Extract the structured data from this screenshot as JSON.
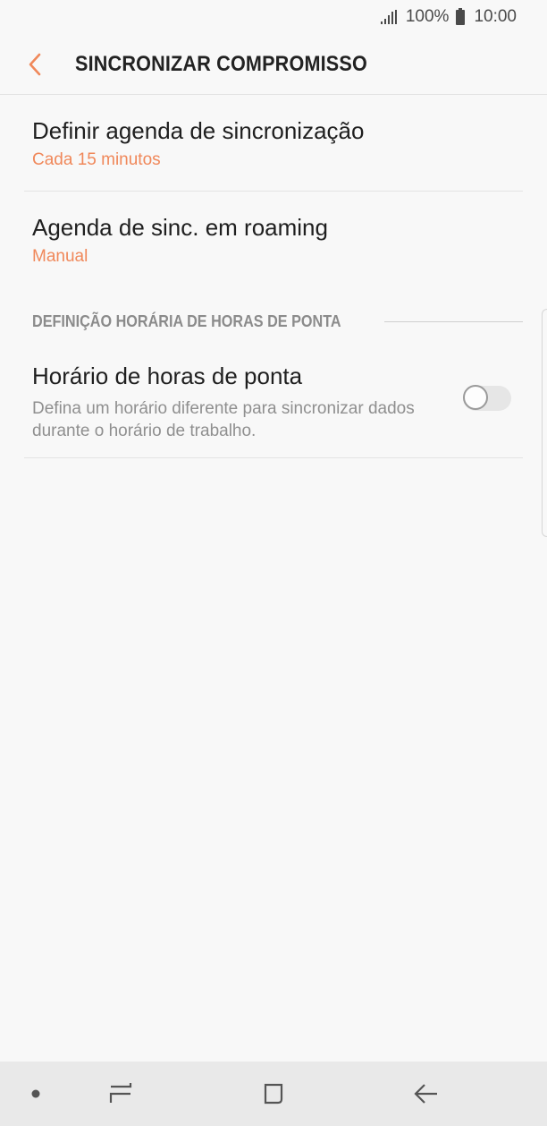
{
  "status_bar": {
    "battery_percent": "100%",
    "time": "10:00",
    "icons": [
      "signal-icon",
      "battery-icon"
    ]
  },
  "app_bar": {
    "title": "SINCRONIZAR COMPROMISSO",
    "back_icon": "chevron-left-icon"
  },
  "settings": [
    {
      "title": "Definir agenda de sincronização",
      "value": "Cada 15 minutos"
    },
    {
      "title": "Agenda de sinc. em roaming",
      "value": "Manual"
    }
  ],
  "section": {
    "label": "DEFINIÇÃO HORÁRIA DE HORAS DE PONTA"
  },
  "peak_hours": {
    "title": "Horário de horas de ponta",
    "description": "Defina um horário diferente para sincronizar dados durante o horário de trabalho.",
    "enabled": false
  },
  "nav_bar": {
    "icons": [
      "dot-icon",
      "recent-apps-icon",
      "home-icon",
      "back-arrow-icon"
    ]
  },
  "colors": {
    "accent": "#f0885a",
    "background": "#f8f8f8",
    "nav_bar": "#e9e9e9"
  }
}
